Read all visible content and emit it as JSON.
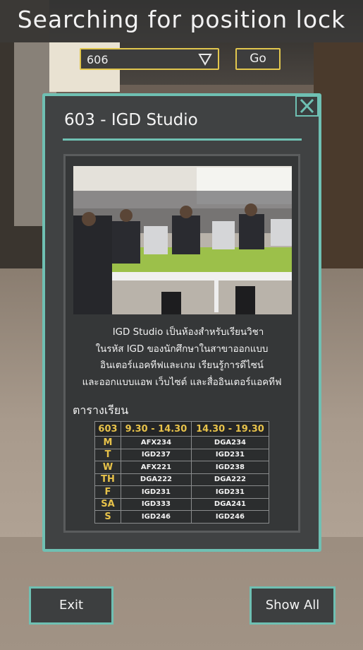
{
  "header": {
    "title": "Searching for position lock"
  },
  "room_select": {
    "value": "606",
    "arrow_icon": "triangle-down-icon"
  },
  "go_button": {
    "label": "Go"
  },
  "panel": {
    "close_icon": "close-icon",
    "title": "603 - IGD Studio",
    "description": [
      "IGD Studio เป็นห้องสำหรับเรียนวิชา",
      "ในรหัส IGD ของนักศึกษาในสาขาออกแบบ",
      "อินเตอร์แอคทีฟและเกม เรียนรู้การดีไซน์",
      "และออกแบบแอพ เว็บไซต์ และสื่ออินเตอร์แอคทีฟ"
    ],
    "schedule_label": "ตารางเรียน",
    "schedule": {
      "headers": [
        "603",
        "9.30 - 14.30",
        "14.30 - 19.30"
      ],
      "rows": [
        [
          "M",
          "AFX234",
          "DGA234"
        ],
        [
          "T",
          "IGD237",
          "IGD231"
        ],
        [
          "W",
          "AFX221",
          "IGD238"
        ],
        [
          "TH",
          "DGA222",
          "DGA222"
        ],
        [
          "F",
          "IGD231",
          "IGD231"
        ],
        [
          "SA",
          "IGD333",
          "DGA241"
        ],
        [
          "S",
          "IGD246",
          "IGD246"
        ]
      ]
    }
  },
  "footer": {
    "exit_label": "Exit",
    "show_all_label": "Show All"
  },
  "colors": {
    "accent": "#6fc0b3",
    "highlight": "#e2c74e",
    "panel_bg": "#404243"
  }
}
